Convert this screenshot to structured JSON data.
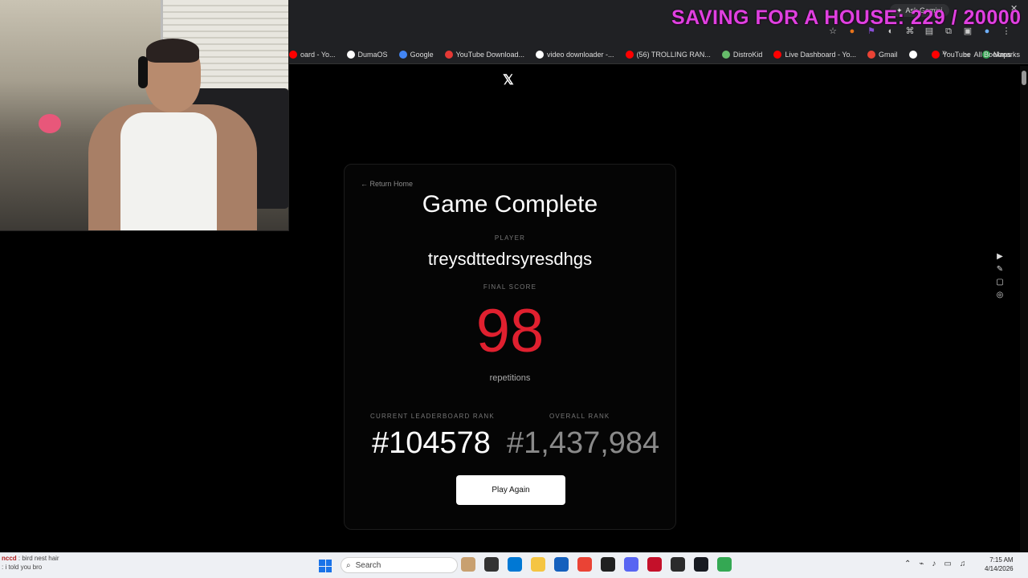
{
  "overlay": {
    "banner": "SAVING FOR A HOUSE: 229 / 20000",
    "chat_user": "nccd",
    "chat_line1": ": bird nest hair",
    "chat_line2": ": i told you bro"
  },
  "browser": {
    "ask_gemini": "Ask Gemini",
    "all_bookmarks": "All Bookmarks",
    "bookmarks": [
      {
        "label": "oard - Yo...",
        "color": "#ff0000"
      },
      {
        "label": "DumaOS",
        "color": "#ffffff"
      },
      {
        "label": "Google",
        "color": "#4285f4"
      },
      {
        "label": "YouTube Download...",
        "color": "#e53935"
      },
      {
        "label": "video downloader -...",
        "color": "#ffffff"
      },
      {
        "label": "(56) TROLLING RAN...",
        "color": "#ff0000"
      },
      {
        "label": "DistroKid",
        "color": "#66bb6a"
      },
      {
        "label": "Live Dashboard - Yo...",
        "color": "#ff0000"
      },
      {
        "label": "Gmail",
        "color": "#ea4335"
      },
      {
        "label": "",
        "color": "#ffffff"
      },
      {
        "label": "YouTube",
        "color": "#ff0000"
      },
      {
        "label": "Maps",
        "color": "#34a853"
      }
    ]
  },
  "page": {
    "x_logo": "𝕏",
    "return_home": "← Return Home",
    "title": "Game Complete",
    "player_label": "PLAYER",
    "player_name": "treysdttedrsyresdhgs",
    "score_label": "FINAL SCORE",
    "score": "98",
    "score_unit": "repetitions",
    "current_rank_label": "CURRENT LEADERBOARD RANK",
    "current_rank": "#104578",
    "overall_rank_label": "OVERALL RANK",
    "overall_rank": "#1,437,984",
    "play_again": "Play Again"
  },
  "taskbar": {
    "search": "Search",
    "time": "7:15 AM",
    "date": "4/14/2026",
    "apps": [
      "#c8a070",
      "#333333",
      "#0078d4",
      "#f5c542",
      "#1560bd",
      "#ea4335",
      "#202020",
      "#5865f2",
      "#c4102a",
      "#2b2b2b",
      "#171a21",
      "#34a853"
    ]
  },
  "colors": {
    "score": "#e0202f",
    "banner": "#e040e0"
  }
}
